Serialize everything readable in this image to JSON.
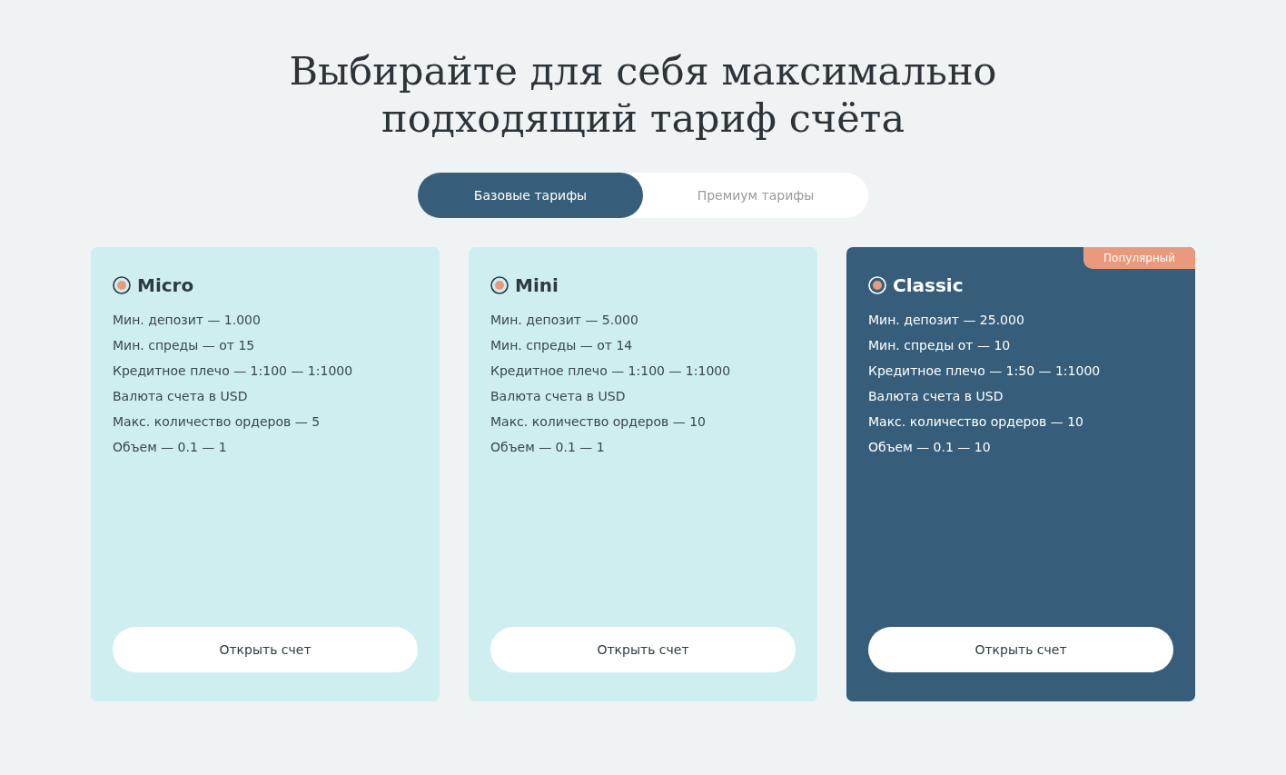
{
  "heading": "Выбирайте для себя максимально подходящий тариф счёта",
  "tabs": [
    {
      "label": "Базовые тарифы",
      "selected": true
    },
    {
      "label": "Премиум тарифы",
      "selected": false
    }
  ],
  "plans": [
    {
      "name": "Micro",
      "highlighted": false,
      "features": [
        "Мин. депозит — 1.000",
        "Мин. спреды — от 15",
        "Кредитное плечо — 1:100 — 1:1000",
        "Валюта счета в USD",
        "Макс. количество ордеров — 5",
        "Объем — 0.1 — 1"
      ],
      "button": "Открыть счет"
    },
    {
      "name": "Mini",
      "highlighted": false,
      "features": [
        "Мин. депозит — 5.000",
        "Мин. спреды — от 14",
        "Кредитное плечо — 1:100 — 1:1000",
        "Валюта счета в USD",
        "Макс. количество ордеров — 10",
        "Объем — 0.1 — 1"
      ],
      "button": "Открыть счет"
    },
    {
      "name": "Classic",
      "highlighted": true,
      "badge": "Популярный",
      "features": [
        "Мин. депозит — 25.000",
        "Мин. спреды от — 10",
        "Кредитное плечо — 1:50 — 1:1000",
        "Валюта счета в USD",
        "Макс. количество ордеров — 10",
        "Объем — 0.1 — 10"
      ],
      "button": "Открыть счет"
    }
  ]
}
